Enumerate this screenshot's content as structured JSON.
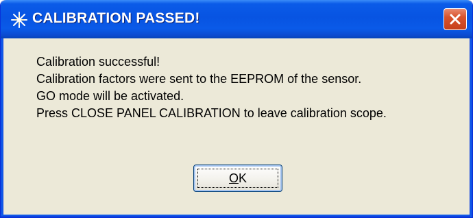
{
  "window": {
    "title": "CALIBRATION PASSED!",
    "icon": "sparkle-star-icon",
    "close_icon": "close-x-icon",
    "titlebar_color": "#0a5be8",
    "close_button_color": "#d9532c"
  },
  "message": {
    "lines": [
      "Calibration successful!",
      "Calibration factors were sent to the EEPROM of the sensor.",
      "GO mode will be activated.",
      "Press CLOSE PANEL CALIBRATION to leave calibration scope."
    ]
  },
  "buttons": {
    "ok": {
      "mnemonic": "O",
      "rest": "K"
    }
  }
}
